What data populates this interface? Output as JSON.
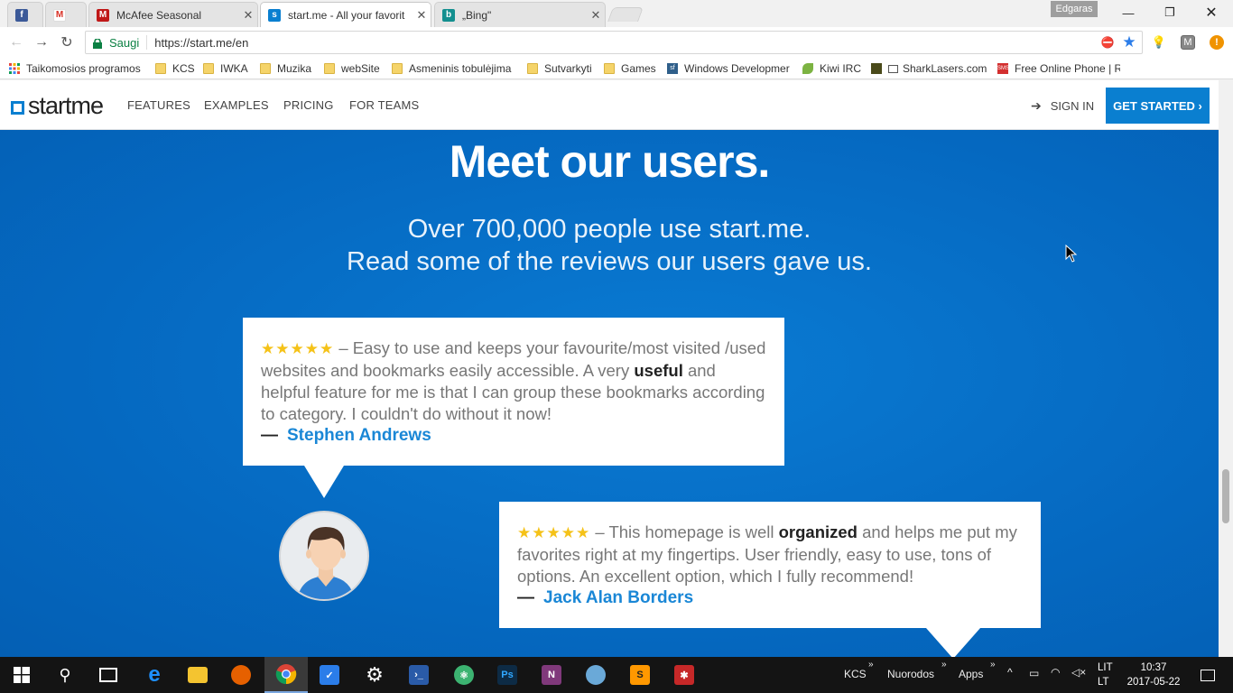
{
  "browser": {
    "tabs": [
      {
        "title": "",
        "icon": "facebook-icon",
        "color": "#3b5998"
      },
      {
        "title": "",
        "icon": "gmail-icon",
        "color": "#d93025"
      },
      {
        "title": "McAfee Seasonal",
        "icon": "mcafee-icon",
        "color": "#c01818"
      },
      {
        "title": "start.me - All your favorit",
        "icon": "startme-icon",
        "color": "#0a7fd0",
        "active": true
      },
      {
        "title": "„Bing\"",
        "icon": "bing-icon",
        "color": "#138f8f"
      }
    ],
    "profile_name": "Edgaras",
    "secure_label": "Saugi",
    "url": "https://start.me/en",
    "bookmarks": [
      {
        "label": "Taikomosios programos",
        "icon": "apps-grid-icon"
      },
      {
        "label": "KCS",
        "icon": "folder-icon"
      },
      {
        "label": "IWKA",
        "icon": "folder-icon"
      },
      {
        "label": "Muzika",
        "icon": "folder-icon"
      },
      {
        "label": "webSite",
        "icon": "folder-icon"
      },
      {
        "label": "Asmeninis tobulėjima",
        "icon": "folder-icon"
      },
      {
        "label": "Sutvarkyti",
        "icon": "folder-icon"
      },
      {
        "label": "Games",
        "icon": "folder-icon"
      },
      {
        "label": "Windows Developmer",
        "icon": "sf-icon"
      },
      {
        "label": "Kiwi IRC",
        "icon": "kiwi-icon"
      },
      {
        "label": "SharkLasers.com",
        "icon": "sharklasers-icon"
      },
      {
        "label": "Free Online Phone | R",
        "icon": "sms-icon"
      }
    ]
  },
  "site": {
    "logo_text": "startme",
    "nav": [
      "FEATURES",
      "EXAMPLES",
      "PRICING",
      "FOR TEAMS"
    ],
    "signin_label": "SIGN IN",
    "cta_label": "GET STARTED ›",
    "accent": "#0a7fd0",
    "headline": "Meet our users.",
    "subtitle_line1": "Over 700,000 people use start.me.",
    "subtitle_line2": "Read some of the reviews our users gave us.",
    "reviews": [
      {
        "stars": "★★★★★",
        "rating": 5,
        "text_before": " – Easy to use and keeps your favourite/most visited /used websites and bookmarks easily accessible. A very ",
        "bold": "useful",
        "text_after": " and helpful feature for me is that I can group these bookmarks according to category. I couldn't do without it now!",
        "author": "Stephen Andrews"
      },
      {
        "stars": "★★★★★",
        "rating": 5,
        "text_before": " – This homepage is well ",
        "bold": "organized",
        "text_after": " and helps me put my favorites right at my fingertips. User friendly, easy to use, tons of options. An excellent option, which I fully recommend!",
        "author": "Jack Alan Borders"
      }
    ],
    "dash": "—"
  },
  "taskbar": {
    "apps": [
      "start-icon",
      "search-icon",
      "task-view-icon",
      "edge-icon",
      "explorer-icon",
      "firefox-icon",
      "chrome-icon",
      "tasks-icon",
      "settings-icon",
      "powershell-icon",
      "atom-icon",
      "photoshop-icon",
      "onenote-icon",
      "app-icon",
      "sublime-icon",
      "tool-icon"
    ],
    "toolbars": [
      "KCS",
      "Nuorodos",
      "Apps"
    ],
    "lang_top": "LIT",
    "lang_bottom": "LT",
    "time": "10:37",
    "date": "2017-05-22"
  }
}
